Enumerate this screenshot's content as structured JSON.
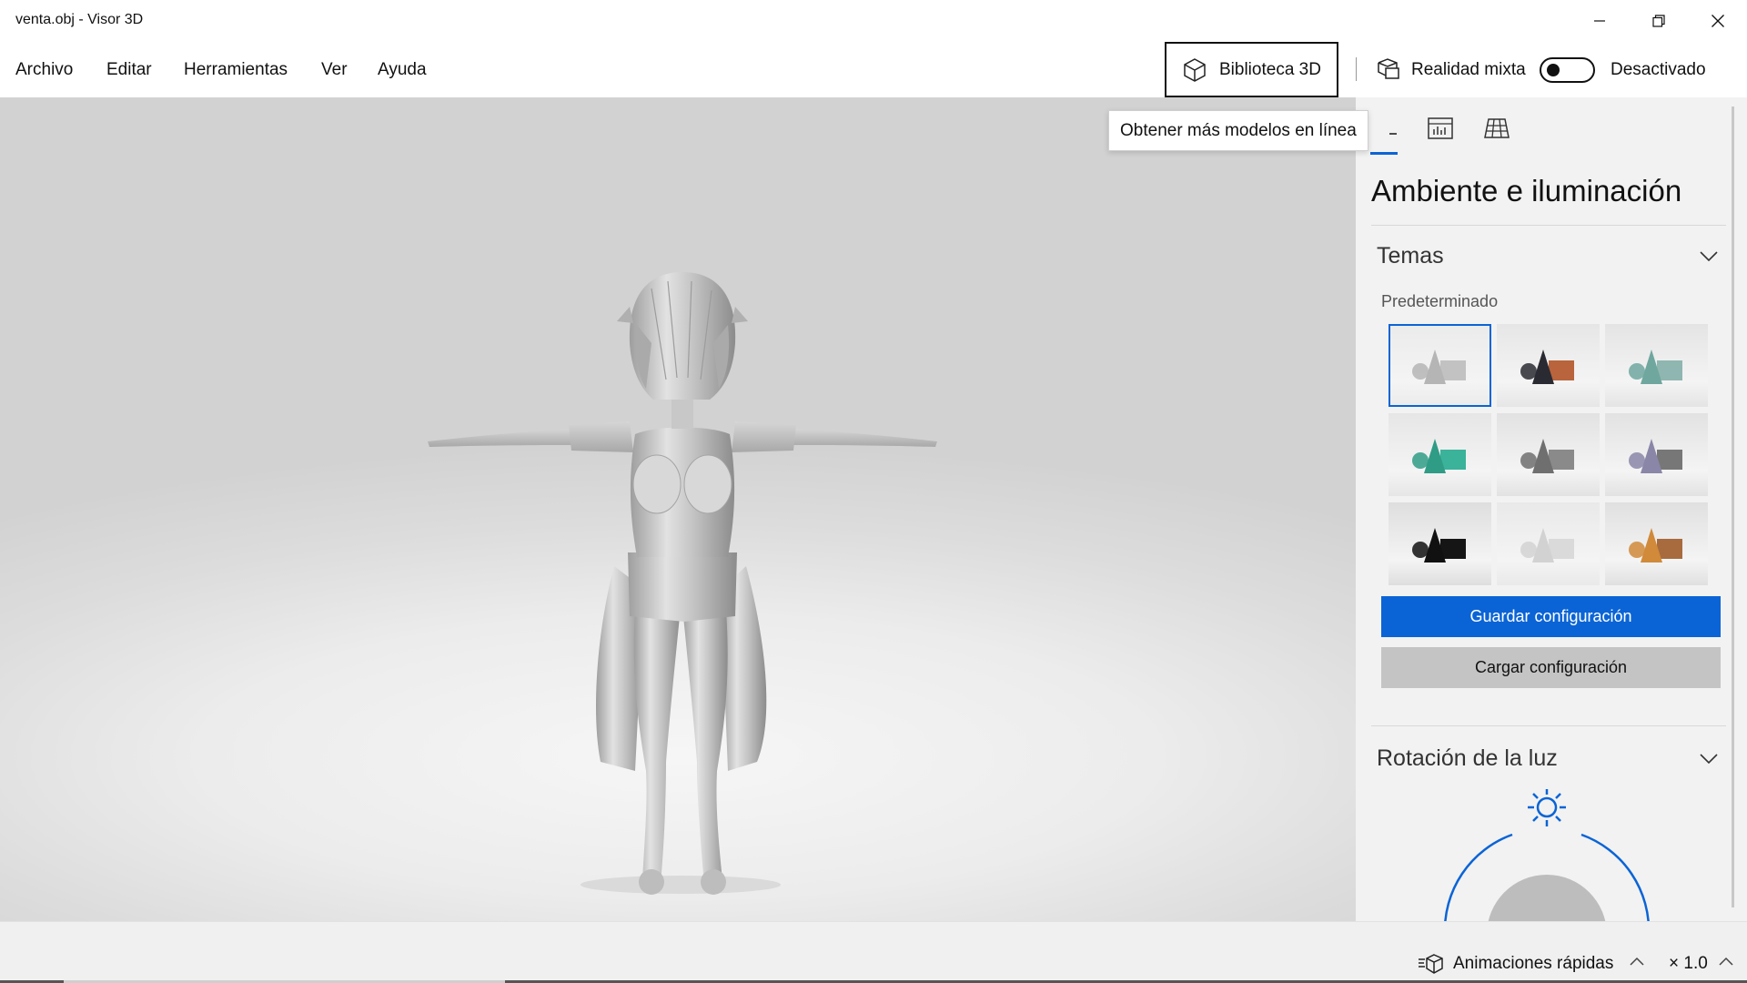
{
  "window": {
    "title": "venta.obj - Visor 3D"
  },
  "menu": {
    "items": [
      "Archivo",
      "Editar",
      "Herramientas",
      "Ver",
      "Ayuda"
    ]
  },
  "toolbar": {
    "library_label": "Biblioteca 3D",
    "mixed_reality_label": "Realidad mixta",
    "mixed_reality_state": "Desactivado",
    "mixed_reality_on": false
  },
  "tooltip": {
    "text": "Obtener más modelos en línea"
  },
  "panel": {
    "title": "Ambiente e iluminación",
    "themes": {
      "title": "Temas",
      "preset_label": "Predeterminado",
      "selected_index": 0,
      "tiles": [
        {
          "bg": "#ebebeb",
          "cone": "#b5b5b5",
          "box": "#c2c2c2"
        },
        {
          "bg": "#e6e6e6",
          "cone": "#2a2a33",
          "box": "#b9643d"
        },
        {
          "bg": "#e4e4e4",
          "cone": "#6fa79f",
          "box": "#8fb6b0"
        },
        {
          "bg": "#e6e6e6",
          "cone": "#2f9c86",
          "box": "#3ab39a"
        },
        {
          "bg": "#e2e2e2",
          "cone": "#6f6f6f",
          "box": "#8a8a8a"
        },
        {
          "bg": "#e2e2e2",
          "cone": "#8a86a8",
          "box": "#777777"
        },
        {
          "bg": "#dedede",
          "cone": "#111111",
          "box": "#151515"
        },
        {
          "bg": "#e9e9e9",
          "cone": "#d2d2d2",
          "box": "#dadada"
        },
        {
          "bg": "#e0e0e0",
          "cone": "#d08a3a",
          "box": "#a86b3e"
        }
      ]
    },
    "save_label": "Guardar configuración",
    "load_label": "Cargar configuración",
    "light_rotation": {
      "title": "Rotación de la luz"
    }
  },
  "statusbar": {
    "animations_label": "Animaciones rápidas",
    "speed_label": "× 1.0"
  },
  "colors": {
    "accent": "#0a64d6"
  }
}
